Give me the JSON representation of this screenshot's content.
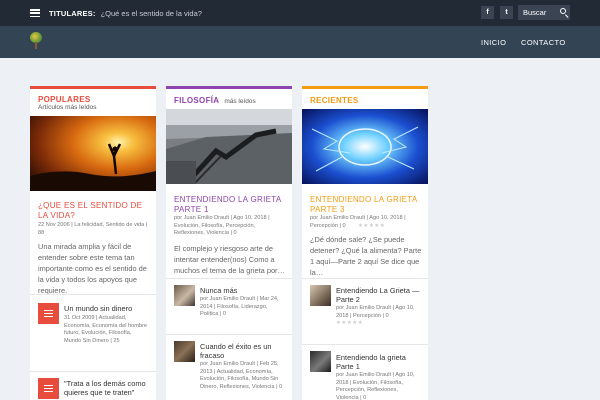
{
  "topbar": {
    "ticker_label": "TITULARES:",
    "ticker_text": "¿Qué es el sentido de la vida?",
    "social": [
      {
        "icon": "facebook-icon",
        "glyph": "f"
      },
      {
        "icon": "twitter-icon",
        "glyph": "t"
      }
    ],
    "search_label": "Buscar"
  },
  "nav": {
    "items": [
      "INICIO",
      "CONTACTO"
    ]
  },
  "columns": [
    {
      "title": "POPULARES",
      "subtitle": "Artículos más leídos",
      "accent": "#e74c3c",
      "featured": {
        "title": "¿QUE ES EL SENTIDO DE LA VIDA?",
        "meta": "22 Nov 2006 | La felicidad, Sentido de vida | 88",
        "excerpt": "Una mirada amplia y fácil de entender sobre este tema tan importante como es el sentido de la vida y todos los apoyos que requiere."
      },
      "items": [
        {
          "title": "Un mundo sin dinero",
          "meta": "31 Oct 2009 | Actualidad, Economía, Economía del hombre futuro, Evolución, Filosofía, Mundo Sin Dinero | 25"
        },
        {
          "title": "\"Trata a los demás como quieres que te traten\"",
          "meta": ""
        }
      ]
    },
    {
      "title": "FILOSOFÍA",
      "subtitle": "más leídos",
      "accent": "#8e44ad",
      "featured": {
        "title": "ENTENDIENDO LA GRIETA PARTE 1",
        "meta": "por Juan Emilio Drault | Ago 10, 2018 | Evolución, Filosofía, Percepción, Reflexiones, Violencia | 0",
        "excerpt": "El complejo y riesgoso arte de intentar entender(nos) Como a muchos el tema de la grieta por…"
      },
      "items": [
        {
          "title": "Nunca más",
          "meta": "por Juan Emilio Drault | Mar 24, 2014 | Filosofía, Liderazgo, Política | 0"
        },
        {
          "title": "Cuando el éxito es un fracaso",
          "meta": "por Juan Emilio Drault | Feb 25, 2013 | Actualidad, Economía, Evolución, Filosofía, Mundo Sin Dinero, Reflexiones, Violencia | 0"
        }
      ]
    },
    {
      "title": "RECIENTES",
      "subtitle": "",
      "accent": "#f39c12",
      "featured": {
        "title": "ENTENDIENDO LA GRIETA PARTE 3",
        "meta": "por Juan Emilio Drault | Ago 10, 2018 | Percepción | 0",
        "excerpt": "¿Dé dónde sale? ¿Se puede detener? ¿Qué la alimenta? Parte 1 aquí—Parte 2 aquí Se dice que la…"
      },
      "items": [
        {
          "title": "Entendiendo La Grieta — Parte 2",
          "meta": "por Juan Emilio Drault | Ago 10, 2018 | Percepción | 0"
        },
        {
          "title": "Entendiendo la grieta Parte 1",
          "meta": "por Juan Emilio Drault | Ago 10, 2018 | Evolución, Filosofía, Percepción, Reflexiones, Violencia | 0"
        }
      ]
    }
  ]
}
